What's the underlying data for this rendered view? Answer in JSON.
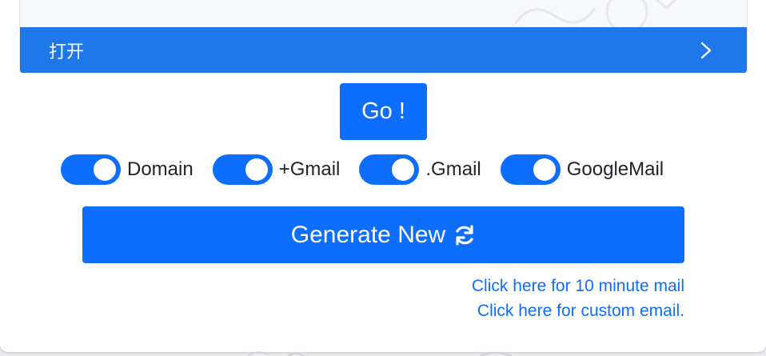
{
  "ad": {
    "open_label": "打开"
  },
  "go_button": {
    "label": "Go !"
  },
  "switches": [
    {
      "label": "Domain",
      "checked": true
    },
    {
      "label": "+Gmail",
      "checked": true
    },
    {
      "label": ".Gmail",
      "checked": true
    },
    {
      "label": "GoogleMail",
      "checked": true
    }
  ],
  "generate_button": {
    "label": "Generate New",
    "icon": "refresh-icon"
  },
  "links": {
    "ten_minute_mail": "Click here for 10 minute mail",
    "custom_email": "Click here for custom email."
  },
  "colors": {
    "primary": "#0d6efd",
    "ad_bar": "#1f78e9",
    "text": "#212529"
  }
}
